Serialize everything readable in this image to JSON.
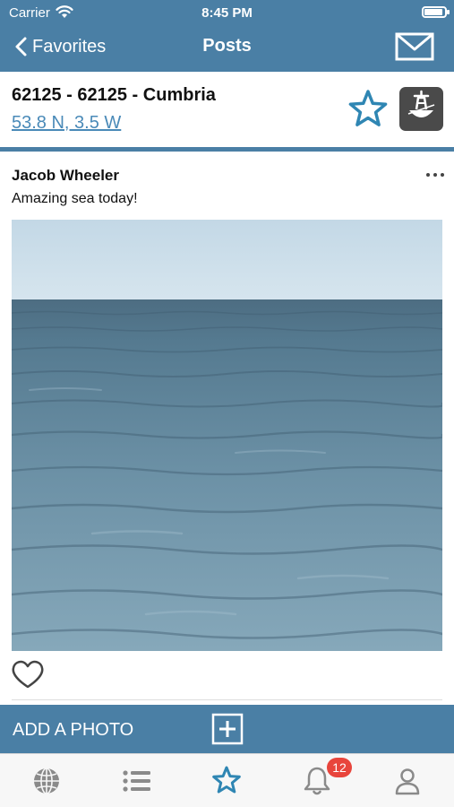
{
  "status_bar": {
    "carrier": "Carrier",
    "time": "8:45 PM",
    "battery_level": 0.9
  },
  "nav": {
    "back_label": "Favorites",
    "title": "Posts"
  },
  "station": {
    "name": "62125 - 62125 - Cumbria",
    "coordinates": "53.8 N, 3.5 W"
  },
  "post": {
    "author": "Jacob Wheeler",
    "text": "Amazing sea today!"
  },
  "add_photo": {
    "label": "ADD A PHOTO"
  },
  "tabbar": {
    "tabs": [
      {
        "icon": "globe-icon"
      },
      {
        "icon": "list-icon"
      },
      {
        "icon": "star-icon",
        "selected": true
      },
      {
        "icon": "bell-icon",
        "badge": "12"
      },
      {
        "icon": "person-icon"
      }
    ]
  },
  "colors": {
    "header_blue": "#4a7fa5",
    "link_blue": "#4a8ab8",
    "tab_active": "#2f86b3",
    "tab_inactive": "#8a8a8a",
    "badge_red": "#e8453c"
  }
}
